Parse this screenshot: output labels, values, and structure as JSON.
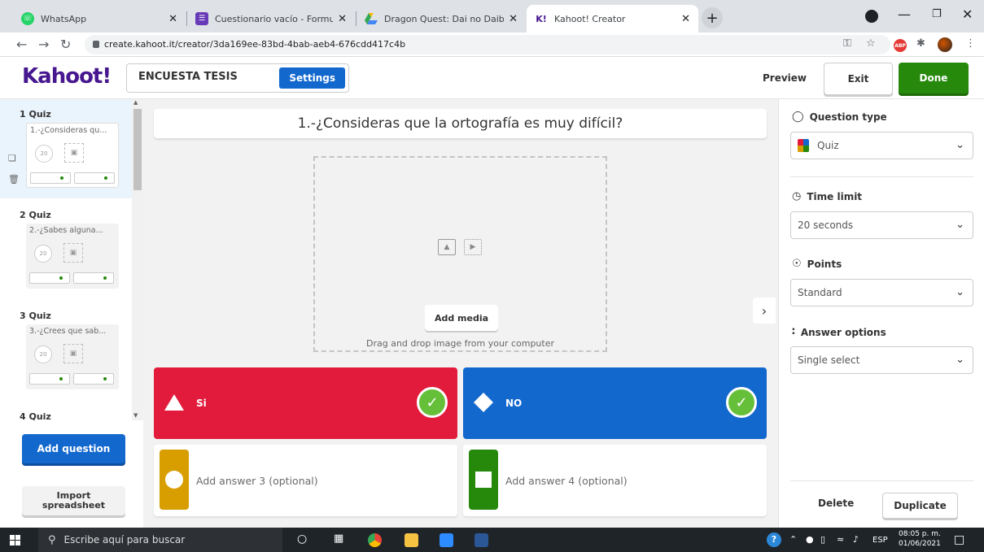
{
  "browser": {
    "tabs": [
      {
        "title": "WhatsApp",
        "active": false
      },
      {
        "title": "Cuestionario vacío - Formularios",
        "active": false
      },
      {
        "title": "Dragon Quest: Dai no Daibouken",
        "active": false
      },
      {
        "title": "Kahoot! Creator",
        "active": true
      }
    ],
    "url": "create.kahoot.it/creator/3da169ee-83bd-4bab-aeb4-676cdd417c4b",
    "abp_label": "ABP"
  },
  "header": {
    "logo": "Kahoot!",
    "kahoot_title": "ENCUESTA TESIS",
    "settings_label": "Settings",
    "preview_label": "Preview",
    "exit_label": "Exit",
    "done_label": "Done"
  },
  "sidebar": {
    "slides": [
      {
        "label": "1 Quiz",
        "text": "1.-¿Consideras qu...",
        "time": "20",
        "active": true
      },
      {
        "label": "2 Quiz",
        "text": "2.-¿Sabes alguna...",
        "time": "20",
        "active": false
      },
      {
        "label": "3 Quiz",
        "text": "3.-¿Crees que sab...",
        "time": "20",
        "active": false
      },
      {
        "label": "4 Quiz",
        "text": "",
        "time": "",
        "active": false
      }
    ],
    "add_question_label": "Add question",
    "import_label": "Import spreadsheet"
  },
  "editor": {
    "question": "1.-¿Consideras que la ortografía es muy difícil?",
    "add_media_label": "Add media",
    "drag_drop_text": "Drag and drop image from your computer",
    "answers": [
      {
        "text": "Si",
        "color": "#e21b3c",
        "shape": "triangle",
        "correct": true,
        "filled": true
      },
      {
        "text": "NO",
        "color": "#1368ce",
        "shape": "diamond",
        "correct": true,
        "filled": true
      },
      {
        "text": "Add answer 3 (optional)",
        "color": "#d89e00",
        "shape": "circle",
        "correct": false,
        "filled": false
      },
      {
        "text": "Add answer 4 (optional)",
        "color": "#26890c",
        "shape": "square",
        "correct": false,
        "filled": false
      }
    ]
  },
  "settings_panel": {
    "question_type_label": "Question type",
    "question_type_value": "Quiz",
    "time_limit_label": "Time limit",
    "time_limit_value": "20 seconds",
    "points_label": "Points",
    "points_value": "Standard",
    "answer_options_label": "Answer options",
    "answer_options_value": "Single select",
    "delete_label": "Delete",
    "duplicate_label": "Duplicate"
  },
  "taskbar": {
    "search_placeholder": "Escribe aquí para buscar",
    "language": "ESP",
    "time": "08:05 p. m.",
    "date": "01/06/2021"
  },
  "colors": {
    "brand_purple": "#46178f",
    "primary_blue": "#1368ce",
    "done_green": "#26890c",
    "answer_red": "#e21b3c",
    "answer_blue": "#1368ce",
    "answer_yellow": "#d89e00",
    "answer_green": "#26890c",
    "correct_check": "#66bf39"
  }
}
